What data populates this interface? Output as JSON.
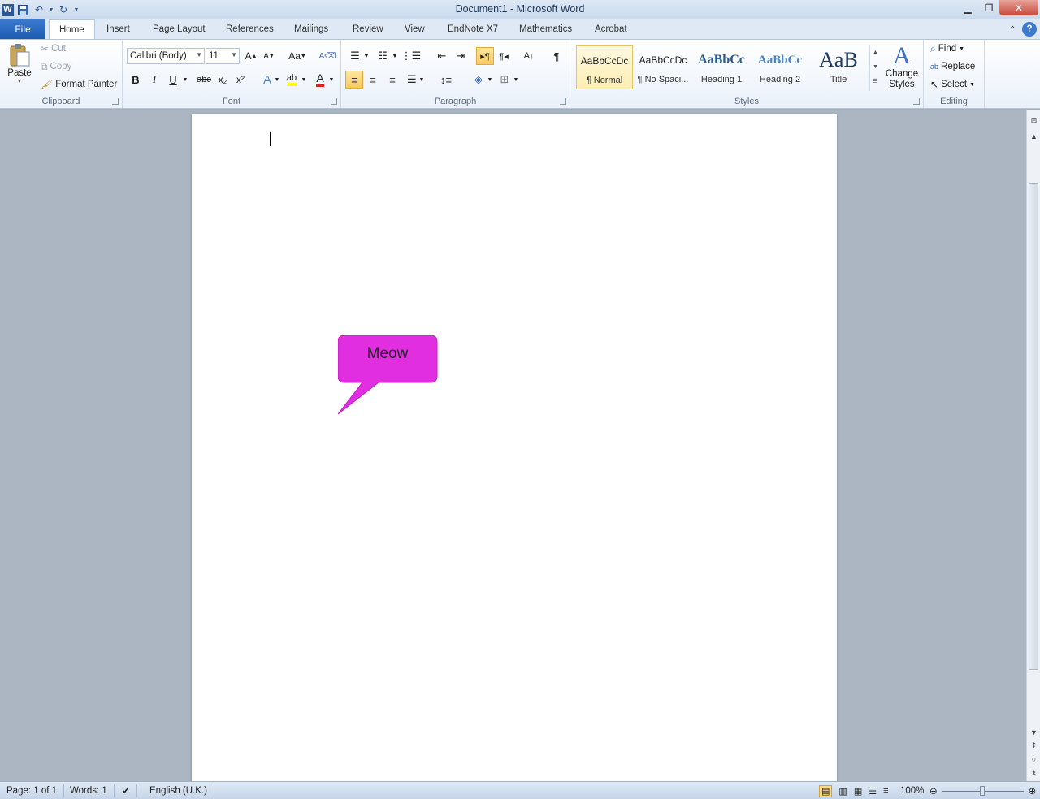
{
  "window": {
    "title": "Document1  -  Microsoft Word"
  },
  "qat": {
    "word_icon": "W"
  },
  "tabs": [
    {
      "label": "File"
    },
    {
      "label": "Home"
    },
    {
      "label": "Insert"
    },
    {
      "label": "Page Layout"
    },
    {
      "label": "References"
    },
    {
      "label": "Mailings"
    },
    {
      "label": "Review"
    },
    {
      "label": "View"
    },
    {
      "label": "EndNote X7"
    },
    {
      "label": "Mathematics"
    },
    {
      "label": "Acrobat"
    }
  ],
  "clipboard": {
    "group": "Clipboard",
    "paste": "Paste",
    "cut": "Cut",
    "copy": "Copy",
    "format_painter": "Format Painter"
  },
  "font": {
    "group": "Font",
    "family": "Calibri (Body)",
    "size": "11",
    "change_case": "Aa",
    "bold": "B",
    "italic": "I",
    "underline": "U",
    "strike": "abc",
    "sub": "x₂",
    "sup": "x²"
  },
  "paragraph": {
    "group": "Paragraph"
  },
  "styles": {
    "group": "Styles",
    "items": [
      {
        "preview": "AaBbCcDc",
        "name": "¶ Normal"
      },
      {
        "preview": "AaBbCcDc",
        "name": "¶ No Spaci..."
      },
      {
        "preview": "AaBbCc",
        "name": "Heading 1"
      },
      {
        "preview": "AaBbCc",
        "name": "Heading 2"
      },
      {
        "preview": "AaB",
        "name": "Title"
      }
    ],
    "change_styles_1": "Change",
    "change_styles_2": "Styles"
  },
  "editing": {
    "group": "Editing",
    "find": "Find",
    "replace": "Replace",
    "select": "Select"
  },
  "document": {
    "callout_text": "Meow",
    "callout_color": "#e02ee0"
  },
  "status": {
    "page": "Page: 1 of 1",
    "words": "Words: 1",
    "language": "English (U.K.)",
    "zoom": "100%"
  }
}
